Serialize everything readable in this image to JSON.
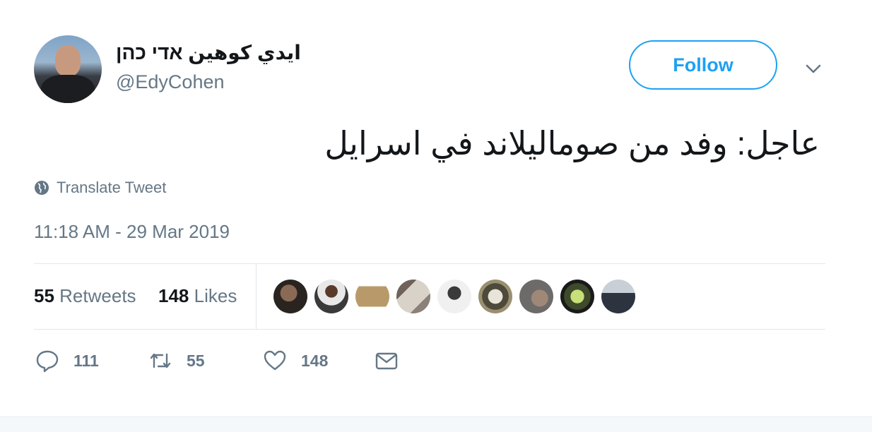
{
  "author": {
    "display_name": "ايدي كوهين אדי כהן",
    "handle": "@EdyCohen"
  },
  "header": {
    "follow_label": "Follow",
    "menu_icon": "chevron-down-icon"
  },
  "tweet": {
    "text": "عاجل: وفد من صوماليلاند في اسرايل",
    "translate_label": "Translate Tweet",
    "timestamp": "11:18 AM - 29 Mar 2019"
  },
  "stats": {
    "retweets_count": "55",
    "retweets_label": "Retweets",
    "likes_count": "148",
    "likes_label": "Likes"
  },
  "actions": {
    "reply_count": "111",
    "retweet_count": "55",
    "like_count": "148"
  },
  "colors": {
    "accent": "#1da1f2",
    "secondary_text": "#657786",
    "divider": "#e1e8ed"
  }
}
